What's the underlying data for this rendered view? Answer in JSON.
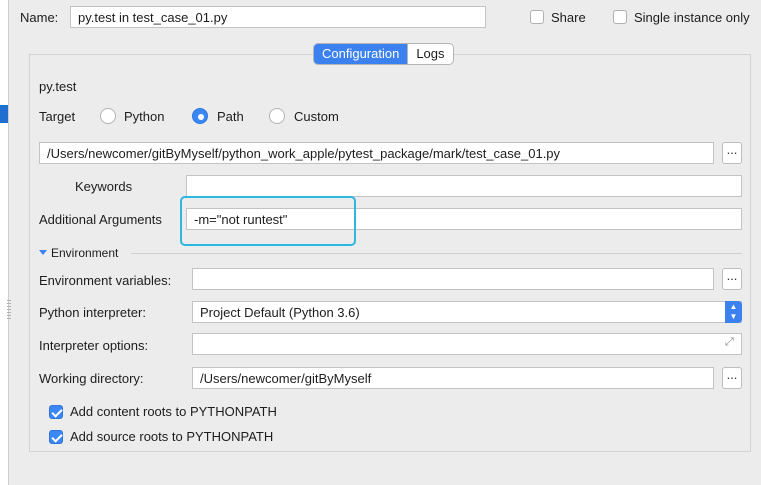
{
  "header": {
    "name_label": "Name:",
    "name_value": "py.test in test_case_01.py",
    "share_label": "Share",
    "single_instance_label": "Single instance only"
  },
  "tabs": [
    {
      "label": "Configuration",
      "active": true
    },
    {
      "label": "Logs",
      "active": false
    }
  ],
  "config": {
    "section_title": "py.test",
    "target_label": "Target",
    "target_options": [
      {
        "label": "Python",
        "selected": false
      },
      {
        "label": "Path",
        "selected": true
      },
      {
        "label": "Custom",
        "selected": false
      }
    ],
    "path_value": "/Users/newcomer/gitByMyself/python_work_apple/pytest_package/mark/test_case_01.py",
    "browse_label": "...",
    "keywords_label": "Keywords",
    "keywords_value": "",
    "additional_args_label": "Additional Arguments",
    "additional_args_value": "-m=\"not runtest\""
  },
  "environment": {
    "section_title": "Environment",
    "env_vars_label": "Environment variables:",
    "env_vars_value": "",
    "interpreter_label": "Python interpreter:",
    "interpreter_value": "Project Default (Python 3.6)",
    "interp_options_label": "Interpreter options:",
    "interp_options_value": "",
    "working_dir_label": "Working directory:",
    "working_dir_value": "/Users/newcomer/gitByMyself",
    "content_roots_label": "Add content roots to PYTHONPATH",
    "content_roots_checked": true,
    "source_roots_label": "Add source roots to PYTHONPATH",
    "source_roots_checked": true
  },
  "colors": {
    "accent": "#3b82f0",
    "highlight": "#2db8e0"
  }
}
